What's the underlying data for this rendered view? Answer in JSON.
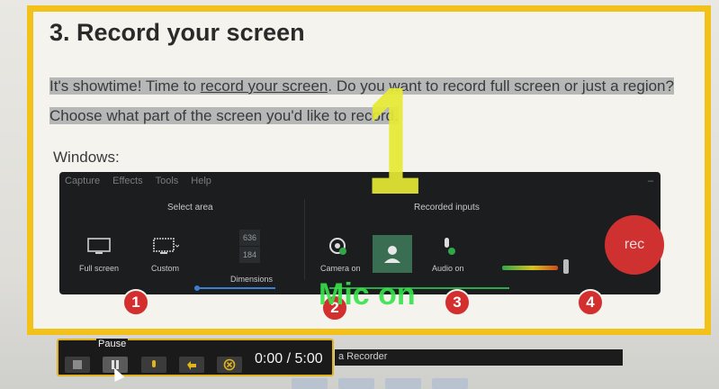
{
  "page": {
    "heading": "3. Record your screen",
    "para_part1": "It's showtime! Time to ",
    "para_link": "record your screen",
    "para_part2": ". Do you want to record full screen or just a region? Choose what part of the screen you'd like to record.",
    "windows_label": "Windows:"
  },
  "recorder_app": {
    "menu": [
      "Capture",
      "Effects",
      "Tools",
      "Help"
    ],
    "close": "–",
    "select_area_label": "Select area",
    "recorded_inputs_label": "Recorded inputs",
    "tools": {
      "full_screen": "Full screen",
      "custom": "Custom",
      "dimensions": "Dimensions",
      "camera_on": "Camera on",
      "audio_on": "Audio on"
    },
    "width": "636",
    "height": "184",
    "rec_label": "rec"
  },
  "badges": [
    "1",
    "2",
    "3",
    "4"
  ],
  "overlay": {
    "big_number": "1",
    "mic_text": "Mic on"
  },
  "control_bar": {
    "pause_tooltip": "Pause",
    "timer": "0:00 / 5:00",
    "strip_text": "a Recorder"
  },
  "colors": {
    "frame_yellow": "#f2c21b",
    "rec_red": "#cf3030",
    "badge_red": "#d32f2f",
    "mic_green": "#37e34a",
    "overlay_yellow": "#e6ea33"
  }
}
